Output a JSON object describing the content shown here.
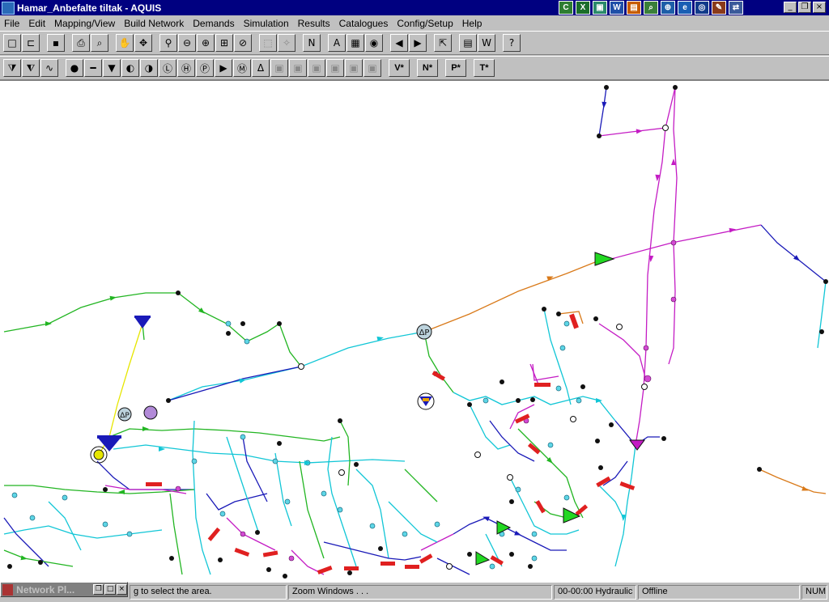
{
  "window": {
    "title": "Hamar_Anbefalte tiltak - AQUIS"
  },
  "tray_icons": [
    {
      "name": "tray-c-icon",
      "glyph": "C",
      "color": "#2e7d32"
    },
    {
      "name": "tray-excel-icon",
      "glyph": "X",
      "color": "#1b6e2a"
    },
    {
      "name": "tray-app-icon",
      "glyph": "▣",
      "color": "#2a8a6a"
    },
    {
      "name": "tray-word-icon",
      "glyph": "W",
      "color": "#1f4fa8"
    },
    {
      "name": "tray-chart-icon",
      "glyph": "▤",
      "color": "#c65c00"
    },
    {
      "name": "tray-search-icon",
      "glyph": "⌕",
      "color": "#3a7f3a"
    },
    {
      "name": "tray-globe-icon",
      "glyph": "⊕",
      "color": "#1d5ea8"
    },
    {
      "name": "tray-explorer-icon",
      "glyph": "e",
      "color": "#1a5fb4"
    },
    {
      "name": "tray-net-icon",
      "glyph": "◎",
      "color": "#103a8a"
    },
    {
      "name": "tray-tools-icon",
      "glyph": "✎",
      "color": "#8a3a1a"
    },
    {
      "name": "tray-sync-icon",
      "glyph": "⇄",
      "color": "#3a5a9a"
    }
  ],
  "menu": [
    {
      "name": "menu-file",
      "label": "File"
    },
    {
      "name": "menu-edit",
      "label": "Edit"
    },
    {
      "name": "menu-mapping-view",
      "label": "Mapping/View"
    },
    {
      "name": "menu-build-network",
      "label": "Build Network"
    },
    {
      "name": "menu-demands",
      "label": "Demands"
    },
    {
      "name": "menu-simulation",
      "label": "Simulation"
    },
    {
      "name": "menu-results",
      "label": "Results"
    },
    {
      "name": "menu-catalogues",
      "label": "Catalogues"
    },
    {
      "name": "menu-config-setup",
      "label": "Config/Setup"
    },
    {
      "name": "menu-help",
      "label": "Help"
    }
  ],
  "toolbar1": [
    {
      "name": "new-file-icon",
      "glyph": "□"
    },
    {
      "name": "open-folder-icon",
      "glyph": "⊏"
    },
    {
      "sep": true
    },
    {
      "name": "save-icon",
      "glyph": "▪"
    },
    {
      "sep": true
    },
    {
      "name": "print-icon",
      "glyph": "⎙"
    },
    {
      "name": "print-preview-icon",
      "glyph": "⌕"
    },
    {
      "sep": true
    },
    {
      "name": "pan-hand-icon",
      "glyph": "✋"
    },
    {
      "name": "move-arrows-icon",
      "glyph": "✥"
    },
    {
      "sep": true
    },
    {
      "name": "zoom-window-icon",
      "glyph": "⚲"
    },
    {
      "name": "zoom-out-icon",
      "glyph": "⊖"
    },
    {
      "name": "zoom-in-icon",
      "glyph": "⊕"
    },
    {
      "name": "zoom-extents-icon",
      "glyph": "⊞"
    },
    {
      "name": "zoom-previous-icon",
      "glyph": "⊘"
    },
    {
      "sep": true
    },
    {
      "name": "select-area-icon",
      "glyph": "⬚",
      "off": true
    },
    {
      "name": "select-node-icon",
      "glyph": "✧",
      "off": true
    },
    {
      "sep": true
    },
    {
      "name": "node-n1-icon",
      "glyph": "N"
    },
    {
      "sep": true
    },
    {
      "name": "text-label-icon",
      "glyph": "A"
    },
    {
      "name": "table-icon",
      "glyph": "▦"
    },
    {
      "name": "lifebuoy-icon",
      "glyph": "◉"
    },
    {
      "sep": true
    },
    {
      "name": "previous-arrow-icon",
      "glyph": "◀"
    },
    {
      "name": "next-arrow-icon",
      "glyph": "▶"
    },
    {
      "sep": true
    },
    {
      "name": "export-icon",
      "glyph": "⇱"
    },
    {
      "sep": true
    },
    {
      "name": "legend-icon",
      "glyph": "▤"
    },
    {
      "name": "w-tool-icon",
      "glyph": "W"
    },
    {
      "sep": true
    },
    {
      "name": "help-question-icon",
      "glyph": "?"
    }
  ],
  "toolbar2": [
    {
      "name": "filter-nodes-icon",
      "glyph": "⧩"
    },
    {
      "name": "filter-links-icon",
      "glyph": "⧨"
    },
    {
      "name": "wave-icon",
      "glyph": "∿"
    },
    {
      "sep": true
    },
    {
      "name": "node-tool-icon",
      "glyph": "●"
    },
    {
      "name": "pipe-tool-icon",
      "glyph": "━"
    },
    {
      "name": "tank-tool-icon",
      "glyph": "▼"
    },
    {
      "name": "valve-tool-icon",
      "glyph": "◐"
    },
    {
      "name": "meter-tool-icon",
      "glyph": "◑"
    },
    {
      "name": "l-tool-icon",
      "glyph": "Ⓛ"
    },
    {
      "name": "h-tool-icon",
      "glyph": "Ⓗ"
    },
    {
      "name": "pp-tool-icon",
      "glyph": "Ⓟ"
    },
    {
      "name": "pump-tool-icon",
      "glyph": "▶"
    },
    {
      "name": "m-tool-icon",
      "glyph": "Ⓜ"
    },
    {
      "name": "dp-tool-icon",
      "glyph": "Δ"
    },
    {
      "name": "disabled-tool-1-icon",
      "glyph": "▣",
      "off": true
    },
    {
      "name": "disabled-tool-2-icon",
      "glyph": "▣",
      "off": true
    },
    {
      "name": "disabled-tool-3-icon",
      "glyph": "▣",
      "off": true
    },
    {
      "name": "disabled-tool-4-icon",
      "glyph": "▣",
      "off": true
    },
    {
      "name": "disabled-tool-5-icon",
      "glyph": "▣",
      "off": true
    },
    {
      "name": "disabled-tool-6-icon",
      "glyph": "▣",
      "off": true
    },
    {
      "sep": true
    },
    {
      "name": "v-star-button",
      "glyph": "V*",
      "wide": true
    },
    {
      "sep": true
    },
    {
      "name": "n-star-button",
      "glyph": "N*",
      "wide": true
    },
    {
      "sep": true
    },
    {
      "name": "p-star-button",
      "glyph": "P*",
      "wide": true
    },
    {
      "sep": true
    },
    {
      "name": "t-star-button",
      "glyph": "T*",
      "wide": true
    }
  ],
  "colors": {
    "pipe_green": "#22b522",
    "pipe_cyan": "#11c6d6",
    "pipe_blue": "#1a1ab8",
    "pipe_magenta": "#c41cc4",
    "pipe_orange": "#d97a1a",
    "pipe_yellow": "#e6e600",
    "node_dark": "#101010",
    "valve_red": "#e02020"
  },
  "status": {
    "hint": "g to select the area.",
    "command": "Zoom Windows . . .",
    "time": "00-00:00 Hydraulic",
    "mode": "Offline",
    "num": "NUM"
  },
  "minimized": {
    "label": "Network Pl..."
  }
}
